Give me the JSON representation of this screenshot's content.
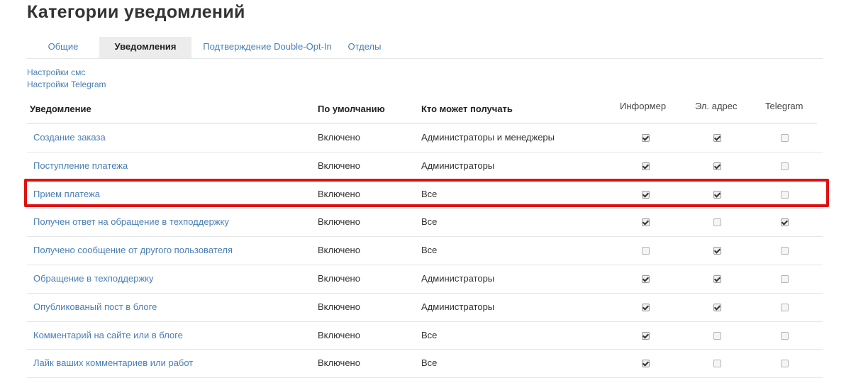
{
  "page_title": "Категории уведомлений",
  "tabs": [
    {
      "label": "Общие",
      "active": false
    },
    {
      "label": "Уведомления",
      "active": true
    },
    {
      "label": "Подтверждение Double-Opt-In",
      "active": false
    },
    {
      "label": "Отделы",
      "active": false
    }
  ],
  "settings_links": {
    "sms": "Настройки смс",
    "telegram": "Настройки Telegram"
  },
  "table": {
    "headers": {
      "notification": "Уведомление",
      "default": "По умолчанию",
      "who": "Кто может получать",
      "informer": "Информер",
      "email": "Эл. адрес",
      "telegram": "Telegram"
    },
    "rows": [
      {
        "name": "Создание заказа",
        "default": "Включено",
        "who": "Администраторы и менеджеры",
        "informer": true,
        "email": true,
        "telegram": false
      },
      {
        "name": "Поступление платежа",
        "default": "Включено",
        "who": "Администраторы",
        "informer": true,
        "email": true,
        "telegram": false
      },
      {
        "name": "Прием платежа",
        "default": "Включено",
        "who": "Все",
        "informer": true,
        "email": true,
        "telegram": false
      },
      {
        "name": "Получен ответ на обращение в техподдержку",
        "default": "Включено",
        "who": "Все",
        "informer": true,
        "email": false,
        "telegram": true
      },
      {
        "name": "Получено сообщение от другого пользователя",
        "default": "Включено",
        "who": "Все",
        "informer": false,
        "email": true,
        "telegram": false
      },
      {
        "name": "Обращение в техподдержку",
        "default": "Включено",
        "who": "Администраторы",
        "informer": true,
        "email": true,
        "telegram": false
      },
      {
        "name": "Опубликованый пост в блоге",
        "default": "Включено",
        "who": "Администраторы",
        "informer": true,
        "email": true,
        "telegram": false
      },
      {
        "name": "Комментарий на сайте или в блоге",
        "default": "Включено",
        "who": "Все",
        "informer": true,
        "email": false,
        "telegram": false
      },
      {
        "name": "Лайк ваших комментариев или работ",
        "default": "Включено",
        "who": "Все",
        "informer": true,
        "email": false,
        "telegram": false
      }
    ]
  },
  "highlighted_row": 2,
  "colors": {
    "link": "#4a7fb5",
    "highlight": "#e01010",
    "active_tab_bg": "#ececec"
  }
}
